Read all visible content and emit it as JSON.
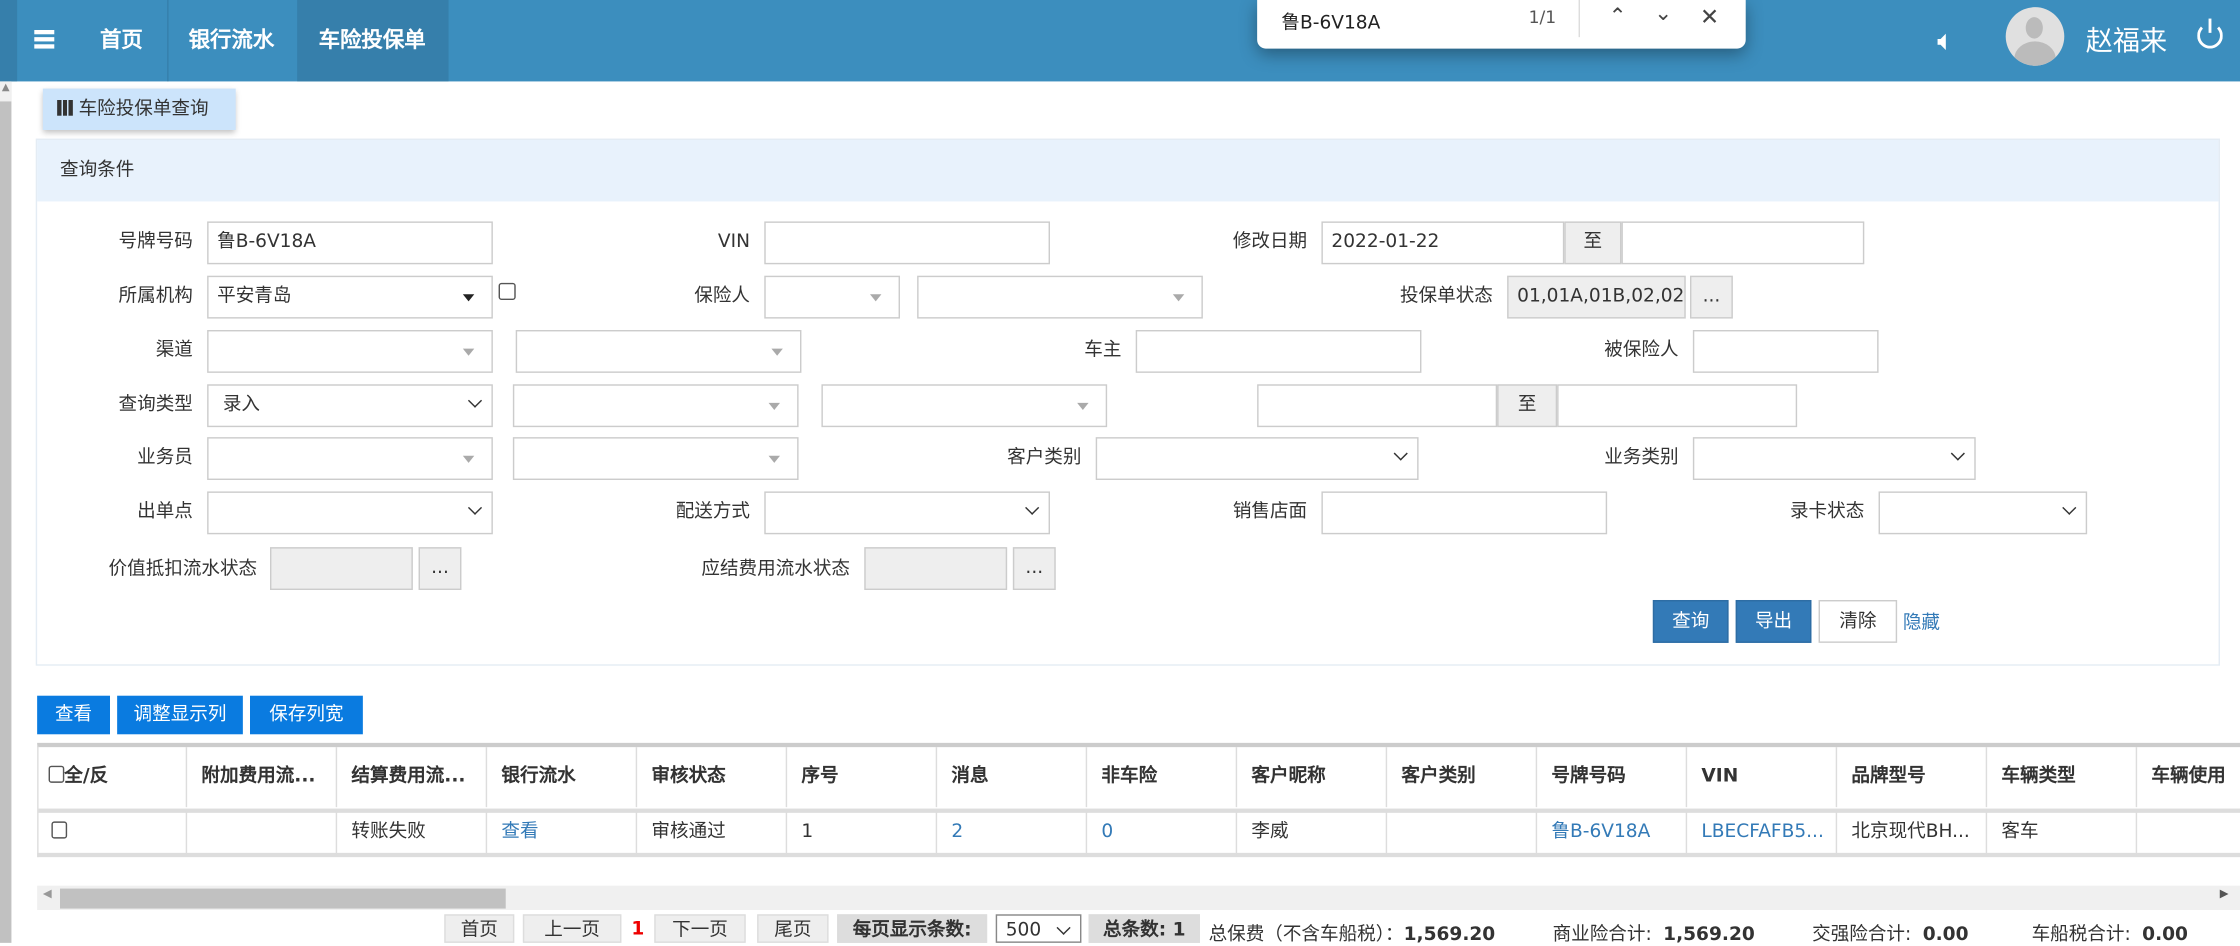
{
  "header": {
    "nav": [
      "首页",
      "银行流水",
      "车险投保单"
    ],
    "user": "赵福来"
  },
  "find": {
    "query": "鲁B-6V18A",
    "count": "1/1"
  },
  "page": {
    "tab_button": "车险投保单查询",
    "panel_title": "查询条件"
  },
  "form": {
    "plate_label": "号牌号码",
    "plate_value": "鲁B-6V18A",
    "vin_label": "VIN",
    "date_label": "修改日期",
    "date_from": "2022-01-22",
    "to": "至",
    "org_label": "所属机构",
    "org_value": "平安青岛",
    "insurer_label": "保险人",
    "status_label": "投保单状态",
    "status_value": "01,01A,01B,02,02",
    "ellipsis": "...",
    "channel_label": "渠道",
    "owner_label": "车主",
    "insured_label": "被保险人",
    "query_type_label": "查询类型",
    "query_type_value": "录入",
    "salesman_label": "业务员",
    "cust_type_label": "客户类别",
    "biz_type_label": "业务类别",
    "issue_point_label": "出单点",
    "delivery_label": "配送方式",
    "store_label": "销售店面",
    "card_status_label": "录卡状态",
    "value_flow_label": "价值抵扣流水状态",
    "fee_flow_label": "应结费用流水状态",
    "search": "查询",
    "export": "导出",
    "clear": "清除",
    "hide": "隐藏"
  },
  "toolbar": [
    "查看",
    "调整显示列",
    "保存列宽"
  ],
  "table": {
    "headers": [
      "全/反",
      "附加费用流...",
      "结算费用流...",
      "银行流水",
      "审核状态",
      "序号",
      "消息",
      "非车险",
      "客户昵称",
      "客户类别",
      "号牌号码",
      "VIN",
      "品牌型号",
      "车辆类型",
      "车辆使用"
    ],
    "row": [
      "",
      "",
      "转账失败",
      "查看",
      "审核通过",
      "1",
      "2",
      "0",
      "李威",
      "",
      "鲁B-6V18A",
      "LBECFAFB5...",
      "北京现代BH...",
      "客车",
      ""
    ]
  },
  "pager": {
    "first": "首页",
    "prev": "上一页",
    "current": "1",
    "next": "下一页",
    "last": "尾页",
    "per_page_label": "每页显示条数:",
    "per_page": "500",
    "total": "总条数: 1",
    "premium_label": "总保费（不含车船税）：",
    "premium": "1,569.20",
    "commercial_label": "商业险合计:",
    "commercial": "1,569.20",
    "compulsory_label": "交强险合计:",
    "compulsory": "0.00",
    "vessel_label": "车船税合计:",
    "vessel": "0.00"
  }
}
